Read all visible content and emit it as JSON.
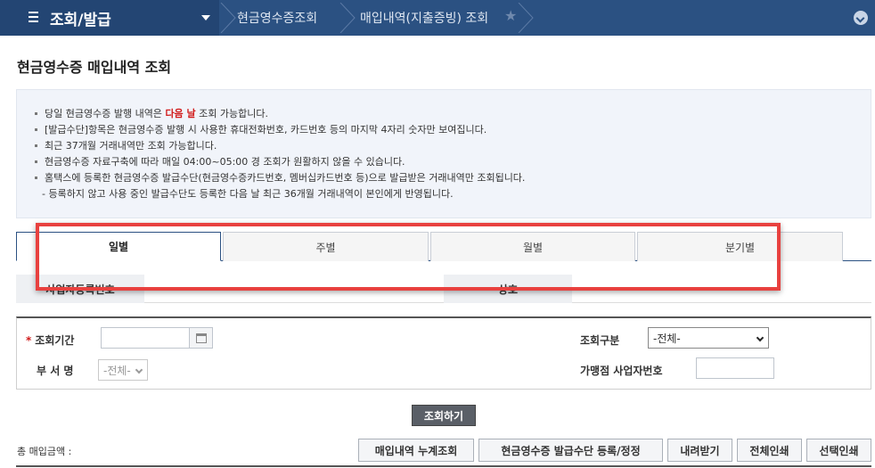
{
  "nav": {
    "main_menu_label": "조회/발급",
    "breadcrumbs": [
      "현금영수증조회",
      "매입내역(지출증빙) 조회"
    ]
  },
  "page_title": "현금영수증 매입내역 조회",
  "notice": {
    "line1_pre": "당일 현금영수증 발행 내역은 ",
    "line1_highlight": "다음 날",
    "line1_post": " 조회 가능합니다.",
    "line2": "[발급수단]항목은 현금영수증 발행 시 사용한 휴대전화번호, 카드번호 등의 마지막 4자리 숫자만 보여집니다.",
    "line3": "최근 37개월 거래내역만 조회 가능합니다.",
    "line4": "현금영수증 자료구축에 따라 매일 04:00~05:00 경 조회가 원활하지 않을 수 있습니다.",
    "line5": "홈택스에 등록한 현금영수증 발급수단(현금영수증카드번호, 멤버십카드번호 등)으로 발급받은 거래내역만 조회됩니다.",
    "line6": "- 등록하지 않고 사용 중인 발급수단도 등록한 다음 날 최근 36개월 거래내역이 본인에게 반영됩니다."
  },
  "tabs": [
    "일별",
    "주별",
    "월별",
    "분기별"
  ],
  "info_row": {
    "label1": "사업자등록번호",
    "label2": "상호"
  },
  "form": {
    "period_label": "조회기간",
    "period_value": "",
    "dept_label": "부 서 명",
    "dept_value": "-전체-",
    "category_label": "조회구분",
    "category_value": "-전체-",
    "merchant_label": "가맹점 사업자번호",
    "merchant_value": ""
  },
  "buttons": {
    "search": "조회하기",
    "cumulative": "매입내역 누계조회",
    "register": "현금영수증 발급수단 등록/정정",
    "download": "내려받기",
    "print_all": "전체인쇄",
    "print_selected": "선택인쇄"
  },
  "total_label": "총 매입금액 :",
  "colors": {
    "nav_bg": "#2b5182",
    "highlight": "#d11b1b",
    "annotation_border": "#e8413f"
  }
}
